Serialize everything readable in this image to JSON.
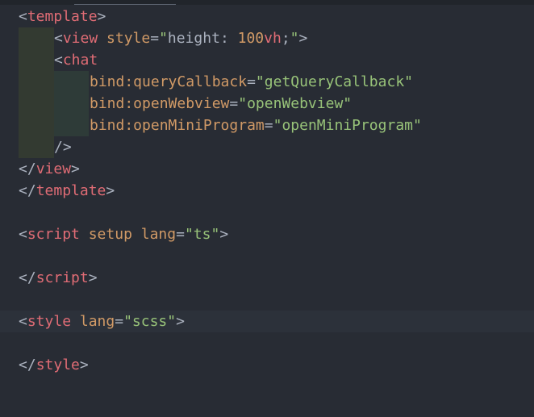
{
  "editor": {
    "lines": [
      {
        "tag": "template"
      },
      {
        "view_tag": "view",
        "view_attr": "style",
        "view_val_pre": "height: ",
        "view_val_num": "100",
        "view_val_unit": "vh",
        "view_val_post": ";"
      },
      {
        "chat_tag": "chat"
      },
      {
        "attr": "bind:queryCallback",
        "val": "getQueryCallback"
      },
      {
        "attr": "bind:openWebview",
        "val": "openWebview"
      },
      {
        "attr": "bind:openMiniProgram",
        "val": "openMiniProgram"
      },
      {
        "selfclose": "/>"
      },
      {
        "close_view": "view"
      },
      {
        "close_template": "template"
      },
      {
        "script_tag": "script",
        "script_attr1": "setup",
        "script_attr2": "lang",
        "script_val": "ts"
      },
      {
        "close_script": "script"
      },
      {
        "style_tag": "style",
        "style_attr": "lang",
        "style_val": "scss"
      },
      {
        "close_style": "style"
      }
    ]
  },
  "colors": {
    "background": "#282c34",
    "tag": "#e06c75",
    "attribute": "#d19a66",
    "string": "#98c379",
    "punctuation": "#abb2bf",
    "current_line": "#2c313a"
  }
}
